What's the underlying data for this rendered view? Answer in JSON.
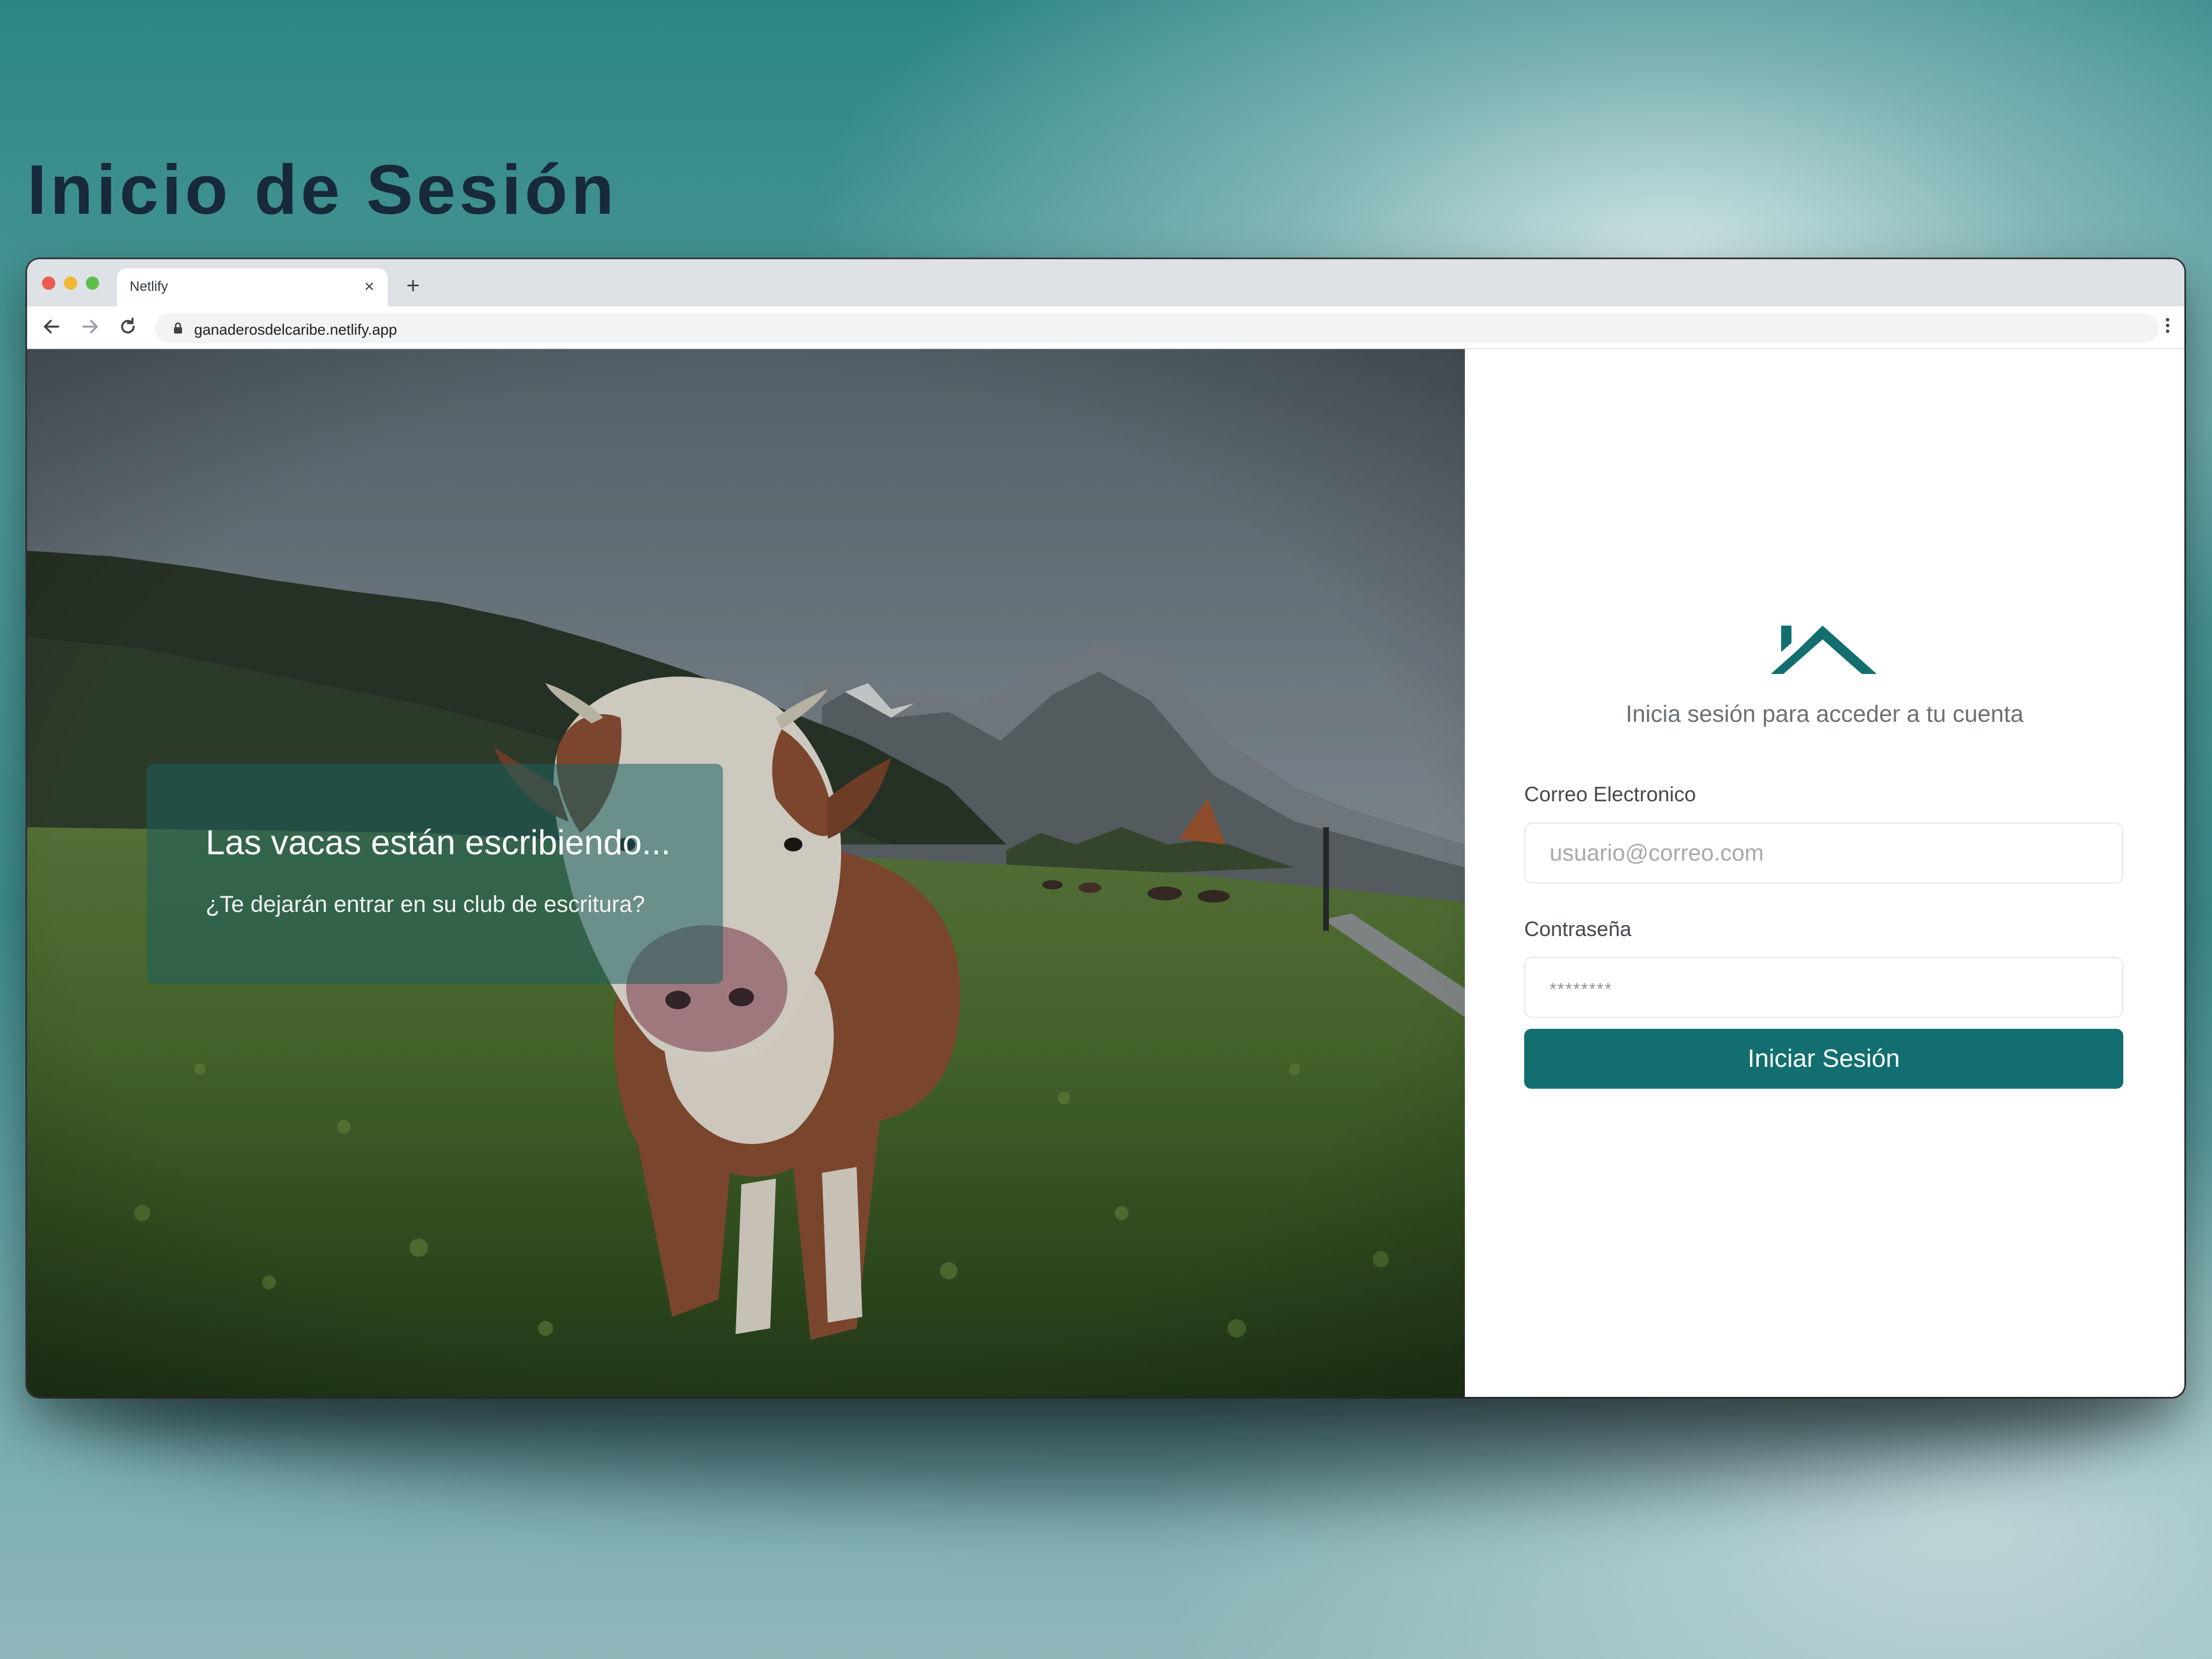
{
  "page": {
    "title": "Inicio de Sesión"
  },
  "browser": {
    "tab_title": "Netlify",
    "tab_close": "×",
    "new_tab": "+",
    "url": "ganaderosdelcaribe.netlify.app"
  },
  "hero": {
    "title": "Las vacas están escribiendo...",
    "subtitle": "¿Te dejarán entrar en su club de escritura?"
  },
  "login": {
    "subtitle": "Inicia sesión para acceder a tu cuenta",
    "email_label": "Correo Electronico",
    "email_placeholder": "usuario@correo.com",
    "password_label": "Contraseña",
    "password_placeholder": "********",
    "submit_label": "Iniciar Sesión"
  },
  "colors": {
    "brand": "#136f6f",
    "title_text": "#17293b",
    "background_teal": "#2c8584"
  },
  "icons": {
    "logo": "house-roof-logo",
    "back": "arrow-left-icon",
    "forward": "arrow-right-icon",
    "reload": "reload-icon",
    "lock": "lock-icon",
    "menu": "kebab-menu-icon"
  }
}
